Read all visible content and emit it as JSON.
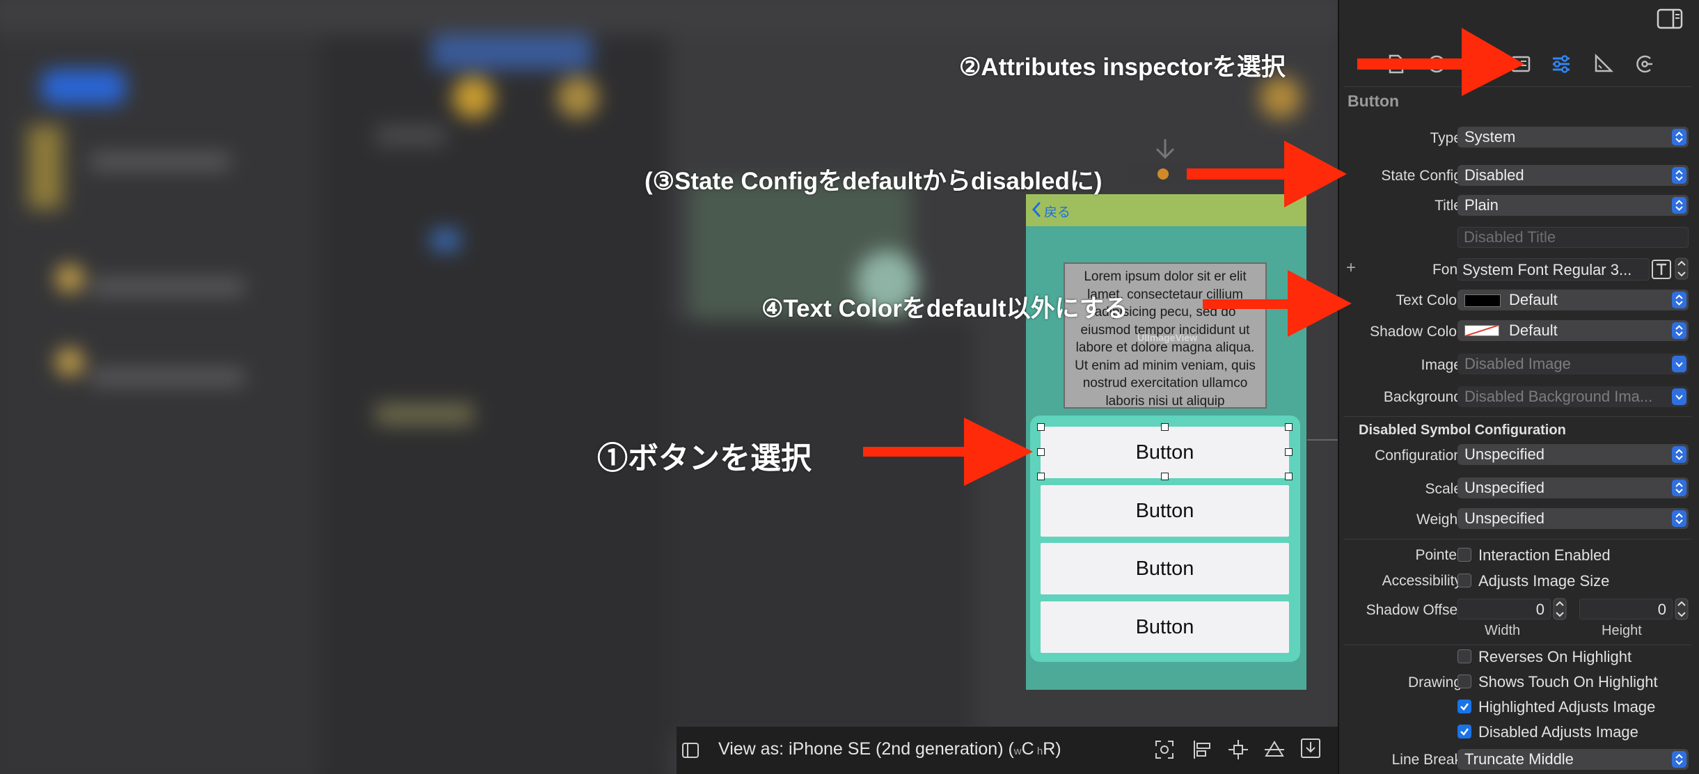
{
  "canvas": {
    "back_label": "戻る",
    "lorem_text": "Lorem ipsum dolor sit er elit lamet, consectetaur cillium adipisicing pecu, sed do eiusmod tempor incididunt ut labore et dolore magna aliqua. Ut enim ad minim veniam, quis nostrud exercitation ullamco laboris nisi ut aliquip",
    "imageview_label": "UIImageView",
    "buttons": [
      "Button",
      "Button",
      "Button",
      "Button"
    ]
  },
  "bottom_bar": {
    "view_as": "View as: iPhone SE (2nd generation) (",
    "w_small": "w",
    "c": "C",
    "h_small": "h",
    "r": "R)"
  },
  "inspector": {
    "section_title": "Button",
    "type": {
      "label": "Type",
      "value": "System"
    },
    "state_config": {
      "label": "State Config",
      "value": "Disabled"
    },
    "title": {
      "label": "Title",
      "value": "Plain"
    },
    "title_placeholder": "Disabled Title",
    "font": {
      "plus": "+",
      "label": "Font",
      "value": "System Font Regular 3..."
    },
    "text_color": {
      "label": "Text Color",
      "value": "Default",
      "swatch": "#000000"
    },
    "shadow_color": {
      "label": "Shadow Color",
      "value": "Default"
    },
    "image": {
      "label": "Image",
      "value": "Disabled Image"
    },
    "background": {
      "label": "Background",
      "value": "Disabled Background Ima..."
    },
    "symbol_header": "Disabled Symbol Configuration",
    "configuration": {
      "label": "Configuration",
      "value": "Unspecified"
    },
    "scale": {
      "label": "Scale",
      "value": "Unspecified"
    },
    "weight": {
      "label": "Weight",
      "value": "Unspecified"
    },
    "pointer": {
      "label": "Pointer",
      "option": "Interaction Enabled",
      "checked": false
    },
    "accessibility": {
      "label": "Accessibility",
      "option": "Adjusts Image Size",
      "checked": false
    },
    "shadow_offset": {
      "label": "Shadow Offset",
      "width": "0",
      "height": "0",
      "width_label": "Width",
      "height_label": "Height"
    },
    "drawing": {
      "label": "Drawing",
      "options": [
        {
          "text": "Reverses On Highlight",
          "checked": false
        },
        {
          "text": "Shows Touch On Highlight",
          "checked": false
        },
        {
          "text": "Highlighted Adjusts Image",
          "checked": true
        },
        {
          "text": "Disabled Adjusts Image",
          "checked": true
        }
      ]
    },
    "line_break": {
      "label": "Line Break",
      "value": "Truncate Middle"
    }
  },
  "annotations": {
    "step1": "①ボタンを選択",
    "step2": "②Attributes inspectorを選択",
    "step3": "(③State Configをdefaultからdisabledに)",
    "step4": "④Text Colorをdefault以外にする",
    "arrow_color": "#ff2a0a"
  },
  "colors": {
    "accent": "#1a73e8",
    "device_bg": "#4daa98",
    "nav_bar": "#9fbf5e",
    "stack_bg": "#5fd3bb"
  }
}
